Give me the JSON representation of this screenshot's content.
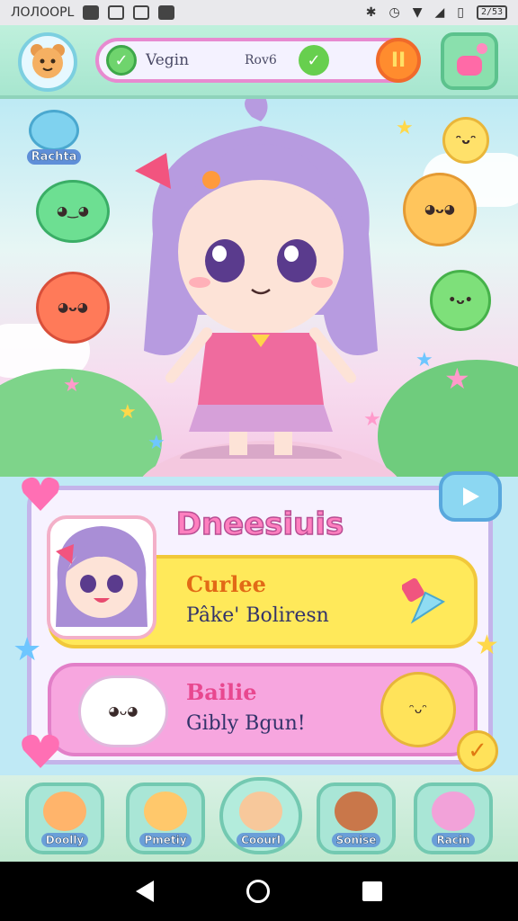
{
  "status_bar": {
    "left_text": "ЛOЛOOPL",
    "battery": "2/53"
  },
  "top_bar": {
    "progress_label_1": "Vegin",
    "progress_label_2": "Rov6",
    "orange_icon": "II",
    "check_mark": "✓"
  },
  "side_badge": {
    "label": "Rachta"
  },
  "panel": {
    "title": "Dneesiuis",
    "card_1": {
      "top": "Curlee",
      "bottom": "Pâke' Boliresn"
    },
    "card_2": {
      "top": "Bailie",
      "bottom": "Gibly Bgun!"
    }
  },
  "tabs": [
    {
      "label": "Doolly",
      "color": "#ffb46b"
    },
    {
      "label": "Pmetiy",
      "color": "#ffc86b"
    },
    {
      "label": "Coourl",
      "color": "#f7c89b"
    },
    {
      "label": "Sonise",
      "color": "#c9774a"
    },
    {
      "label": "Racin",
      "color": "#f2a2d9"
    }
  ],
  "colors": {
    "accent_pink": "#ff7fbf",
    "card_yellow": "#ffe95a",
    "card_pink": "#f7a6df",
    "teal": "#a9e6d6"
  }
}
